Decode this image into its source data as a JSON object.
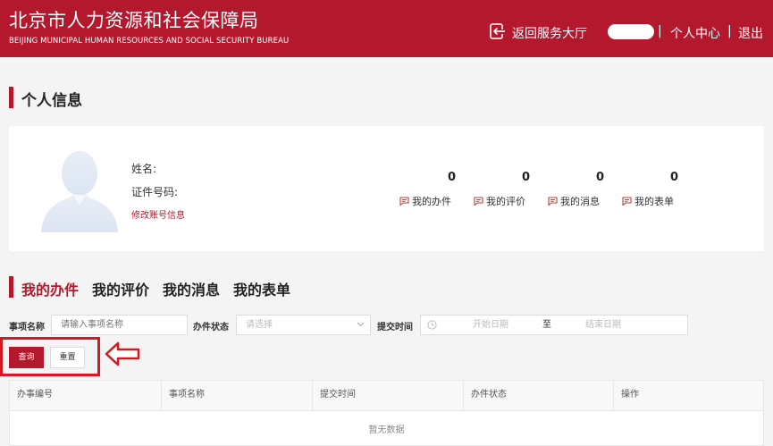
{
  "header": {
    "title_cn": "北京市人力资源和社会保障局",
    "title_en": "BEIJING MUNICIPAL HUMAN RESOURCES AND SOCIAL SECURITY BUREAU",
    "hall_link": "返回服务大厅",
    "separator": "|",
    "center_link": "个人中心",
    "logout_link": "退出",
    "bg_color": "#b3182d"
  },
  "profile": {
    "section_title": "个人信息",
    "name_label": "姓名:",
    "id_label": "证件号码:",
    "edit_link": "修改账号信息",
    "stats": [
      {
        "count": "0",
        "label": "我的办件",
        "icon": "message-icon"
      },
      {
        "count": "0",
        "label": "我的评价",
        "icon": "message-icon"
      },
      {
        "count": "0",
        "label": "我的消息",
        "icon": "message-icon"
      },
      {
        "count": "0",
        "label": "我的表单",
        "icon": "message-icon"
      }
    ]
  },
  "tabs": [
    {
      "label": "我的办件",
      "active": true
    },
    {
      "label": "我的评价",
      "active": false
    },
    {
      "label": "我的消息",
      "active": false
    },
    {
      "label": "我的表单",
      "active": false
    }
  ],
  "filters": {
    "name_label": "事项名称",
    "name_placeholder": "请输入事项名称",
    "status_label": "办件状态",
    "status_placeholder": "请选择",
    "time_label": "提交时间",
    "start_placeholder": "开始日期",
    "range_sep": "至",
    "end_placeholder": "结束日期",
    "query_button": "查询",
    "reset_button": "重置"
  },
  "table": {
    "columns": [
      "办事编号",
      "事项名称",
      "提交时间",
      "办件状态",
      "操作"
    ],
    "empty_text": "暂无数据"
  }
}
